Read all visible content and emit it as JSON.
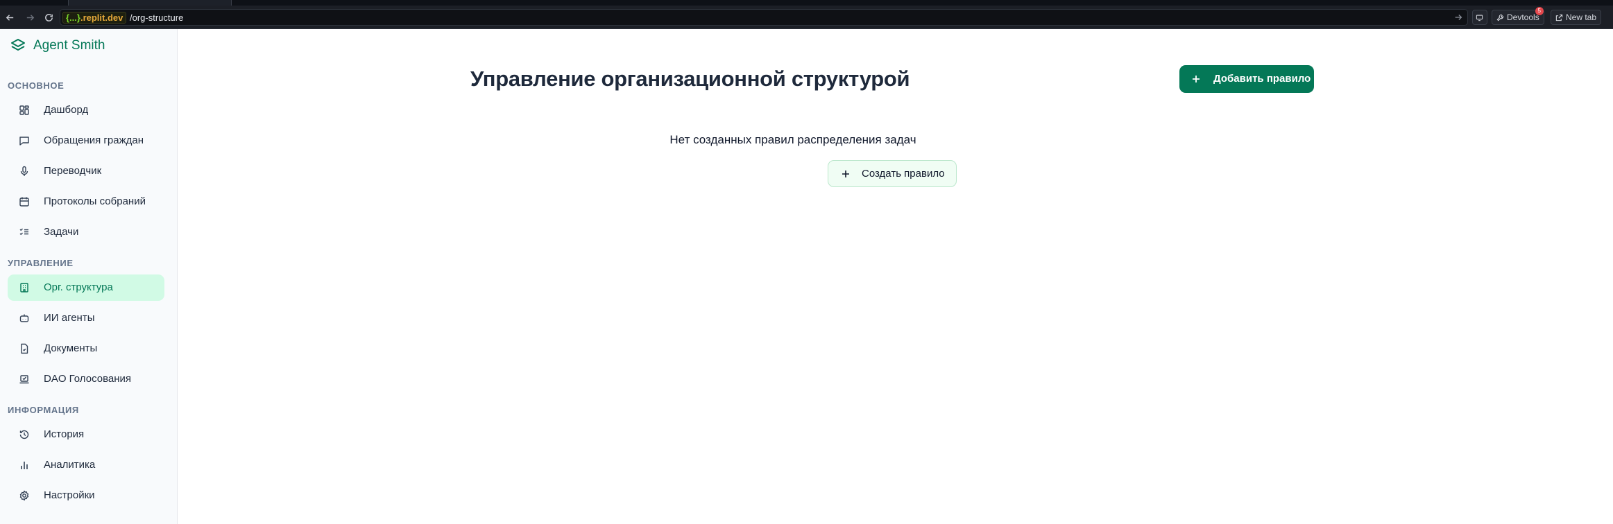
{
  "browser": {
    "domain_placeholder": "{...}",
    "domain_suffix": ".replit.dev",
    "path": "/org-structure",
    "devtools_label": "Devtools",
    "devtools_badge": "5",
    "new_tab_label": "New tab"
  },
  "sidebar": {
    "brand": "Agent Smith",
    "sections": [
      {
        "label": "ОСНОВНОЕ",
        "items": [
          {
            "label": "Дашборд",
            "icon": "dashboard-grid-icon"
          },
          {
            "label": "Обращения граждан",
            "icon": "message-icon"
          },
          {
            "label": "Переводчик",
            "icon": "microphone-icon"
          },
          {
            "label": "Протоколы собраний",
            "icon": "calendar-icon"
          },
          {
            "label": "Задачи",
            "icon": "checklist-icon"
          }
        ]
      },
      {
        "label": "УПРАВЛЕНИЕ",
        "items": [
          {
            "label": "Орг. структура",
            "icon": "building-icon",
            "active": true
          },
          {
            "label": "ИИ агенты",
            "icon": "bot-icon"
          },
          {
            "label": "Документы",
            "icon": "document-icon"
          },
          {
            "label": "DAO Голосования",
            "icon": "vote-icon"
          }
        ]
      },
      {
        "label": "ИНФОРМАЦИЯ",
        "items": [
          {
            "label": "История",
            "icon": "history-icon"
          },
          {
            "label": "Аналитика",
            "icon": "bar-chart-icon"
          },
          {
            "label": "Настройки",
            "icon": "gear-icon"
          }
        ]
      }
    ]
  },
  "main": {
    "title": "Управление организационной структурой",
    "add_button": "Добавить правило",
    "empty_message": "Нет созданных правил распределения задач",
    "create_button": "Создать правило"
  },
  "colors": {
    "accent": "#047857",
    "active_bg": "#d1fae5"
  }
}
